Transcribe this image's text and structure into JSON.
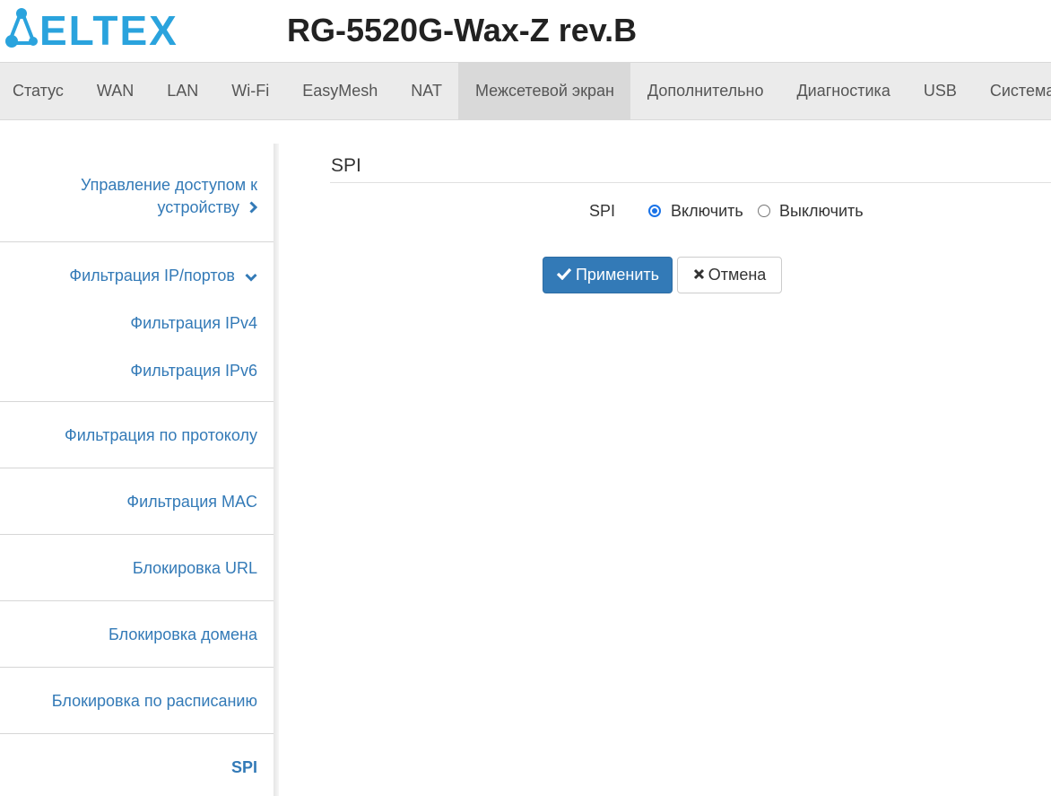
{
  "header": {
    "logo_text": "ELTEX",
    "device_title": "RG-5520G-Wax-Z rev.B",
    "brand_color": "#2aa3dd"
  },
  "topnav": {
    "items": [
      "Статус",
      "WAN",
      "LAN",
      "Wi-Fi",
      "EasyMesh",
      "NAT",
      "Межсетевой экран",
      "Дополнительно",
      "Диагностика",
      "USB",
      "Система"
    ],
    "active": "Межсетевой экран"
  },
  "sidebar": {
    "access_line1": "Управление доступом к",
    "access_line2": "устройству",
    "ip_filter": "Фильтрация IP/портов",
    "ipv4": "Фильтрация IPv4",
    "ipv6": "Фильтрация IPv6",
    "protocol": "Фильтрация по протоколу",
    "mac": "Фильтрация MAC",
    "url": "Блокировка URL",
    "domain": "Блокировка домена",
    "schedule": "Блокировка по расписанию",
    "spi": "SPI",
    "active": "SPI"
  },
  "main": {
    "section_title": "SPI",
    "spi_label": "SPI",
    "option_on": "Включить",
    "option_off": "Выключить",
    "selected": "Включить",
    "apply_label": "Применить",
    "cancel_label": "Отмена"
  },
  "icons": {
    "logo": "eltex-network-logo-icon",
    "chevron_right": "chevron-right-icon",
    "chevron_down": "chevron-down-icon",
    "apply": "check-icon",
    "cancel": "close-icon"
  }
}
